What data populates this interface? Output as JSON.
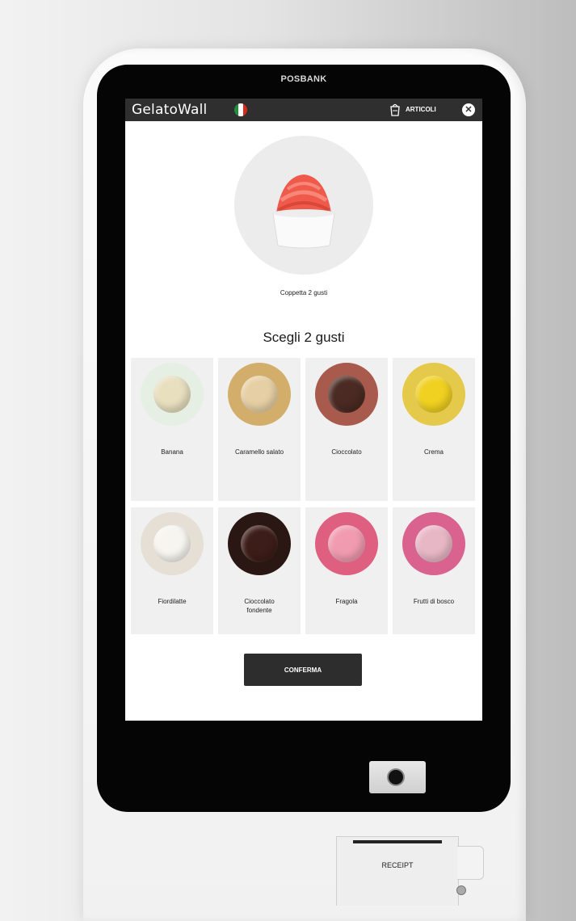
{
  "device": {
    "brand": "POSBANK",
    "receipt_label": "RECEIPT"
  },
  "header": {
    "logo": "GelatoWall",
    "language_icon": "italy-flag-icon",
    "cart_label": "ARTICOLI",
    "cart_icon": "cart-icon",
    "close_icon": "close-icon",
    "bar_color": "#2f2f2f"
  },
  "product": {
    "name": "Coppetta 2 gusti"
  },
  "section_title": "Scegli 2 gusti",
  "flavors": [
    {
      "name": "Banana",
      "circle_color": "#e5efe3",
      "scoop_color": "#e8dfbf"
    },
    {
      "name": "Caramello salato",
      "circle_color": "#d3ae6a",
      "scoop_color": "#e6cfa4"
    },
    {
      "name": "Cioccolato",
      "circle_color": "#a85a4c",
      "scoop_color": "#4a2a22"
    },
    {
      "name": "Crema",
      "circle_color": "#e5c94a",
      "scoop_color": "#f0d020"
    },
    {
      "name": "Fiordilatte",
      "circle_color": "#e6dfd6",
      "scoop_color": "#f7f5ef"
    },
    {
      "name": "Cioccolato fondente",
      "circle_color": "#2a1713",
      "scoop_color": "#3d1d18"
    },
    {
      "name": "Fragola",
      "circle_color": "#df5f80",
      "scoop_color": "#f19bb0"
    },
    {
      "name": "Frutti di bosco",
      "circle_color": "#d9628f",
      "scoop_color": "#e8b7c6"
    }
  ],
  "confirm_label": "CONFERMA"
}
